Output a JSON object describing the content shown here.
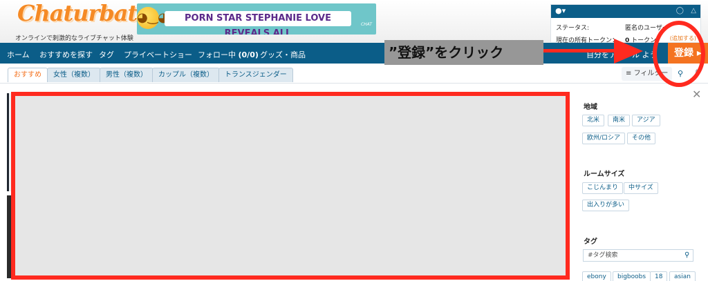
{
  "header": {
    "logo": "Chaturbate",
    "tagline": "オンラインで刺激的なライブチャット体験",
    "ad_text": "PORN STAR STEPHANIE LOVE REVEALS ALL",
    "ad_mark": "CHAT"
  },
  "user_panel": {
    "status_label": "ステータス:",
    "status_value": "匿名のユーザー",
    "tokens_label": "現在の所有トークン：",
    "tokens_count": "0",
    "tokens_unit": "トークン",
    "add_link": "(追加する)"
  },
  "nav": {
    "items": [
      "ホーム",
      "おすすめを探す",
      "タグ",
      "プライベートショー",
      "フォロー中",
      "グッズ・商品"
    ],
    "follow_count": "(0/0)",
    "cta_partial": "自分をアピール",
    "cta_suffix": "よう",
    "signup_label": "登録 ▸"
  },
  "tabs": {
    "items": [
      "おすすめ",
      "女性（複数）",
      "男性（複数）",
      "カップル（複数）",
      "トランスジェンダー"
    ],
    "active_index": 0,
    "filter_label": "フィルター"
  },
  "sidebar": {
    "region_title": "地域",
    "regions": [
      "北米",
      "南米",
      "アジア",
      "欧州/ロシア",
      "その他"
    ],
    "room_size_title": "ルームサイズ",
    "room_sizes": [
      "こじんまり",
      "中サイズ",
      "出入りが多い"
    ],
    "tag_title": "タグ",
    "tag_search_placeholder": "#タグ検索",
    "tags": [
      "ebony",
      "bigboobs",
      "18",
      "asian"
    ]
  },
  "annotation": {
    "label": "”登録”をクリック",
    "color": "#ff2a1f"
  },
  "colors": {
    "brand_orange": "#f47321",
    "nav_blue": "#0b5d88"
  }
}
